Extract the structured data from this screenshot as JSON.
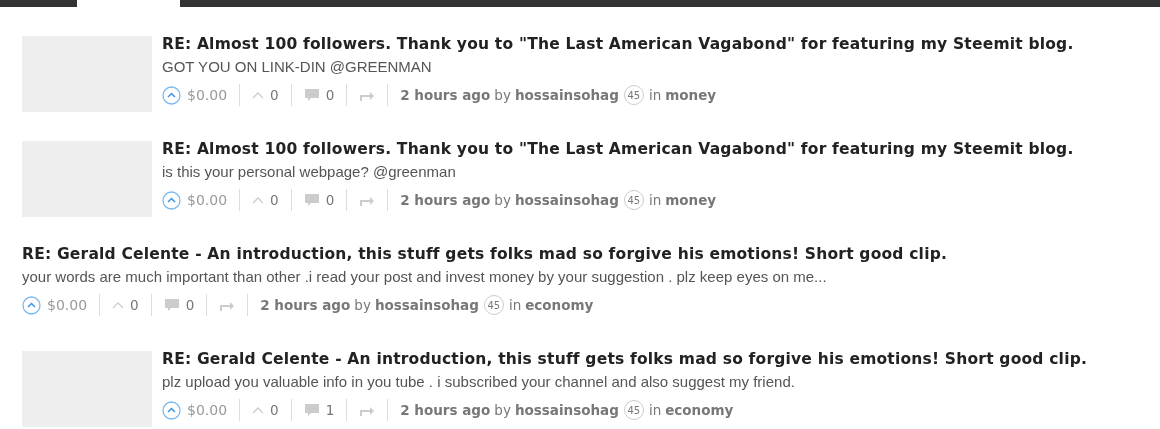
{
  "posts": [
    {
      "has_thumbnail": true,
      "title": "RE: Almost 100 followers. Thank you to \"The Last American Vagabond\" for featuring my Steemit blog.",
      "body": "GOT YOU ON LINK-DIN @GREENMAN",
      "payout": "$0.00",
      "votes": "0",
      "comments": "0",
      "time": "2 hours ago",
      "by": "by",
      "author": "hossainsohag",
      "reputation": "45",
      "in": "in",
      "category": "money"
    },
    {
      "has_thumbnail": true,
      "title": "RE: Almost 100 followers. Thank you to \"The Last American Vagabond\" for featuring my Steemit blog.",
      "body": "is this your personal webpage? @greenman",
      "payout": "$0.00",
      "votes": "0",
      "comments": "0",
      "time": "2 hours ago",
      "by": "by",
      "author": "hossainsohag",
      "reputation": "45",
      "in": "in",
      "category": "money"
    },
    {
      "has_thumbnail": false,
      "title": "RE: Gerald Celente - An introduction, this stuff gets folks mad so forgive his emotions! Short good clip.",
      "body": "your words are much important than other .i read your post and invest money by your suggestion . plz keep eyes on me...",
      "payout": "$0.00",
      "votes": "0",
      "comments": "0",
      "time": "2 hours ago",
      "by": "by",
      "author": "hossainsohag",
      "reputation": "45",
      "in": "in",
      "category": "economy"
    },
    {
      "has_thumbnail": true,
      "title": "RE: Gerald Celente - An introduction, this stuff gets folks mad so forgive his emotions! Short good clip.",
      "body": "plz upload you valuable info in you tube . i subscribed your channel and also suggest my friend.",
      "payout": "$0.00",
      "votes": "0",
      "comments": "1",
      "time": "2 hours ago",
      "by": "by",
      "author": "hossainsohag",
      "reputation": "45",
      "in": "in",
      "category": "economy"
    }
  ]
}
